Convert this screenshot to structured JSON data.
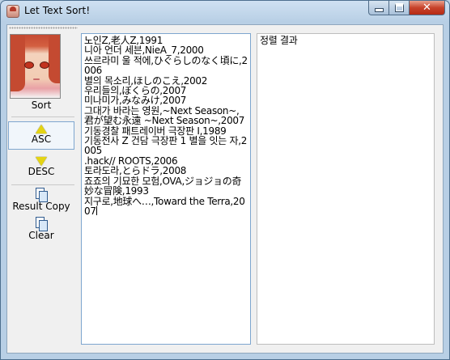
{
  "window": {
    "title": "Let Text Sort!",
    "close_glyph": "✕"
  },
  "sidebar": {
    "sort_label": "Sort",
    "asc_label": "ASC",
    "desc_label": "DESC",
    "copy_label": "Result Copy",
    "clear_label": "Clear"
  },
  "input": {
    "text": "노인Z,老人Z,1991\n니아 언더 세븐,NieA_7,2000\n쓰르라미 울 적에,ひぐらしのなく頃に,2006\n별의 목소리,ほしのこえ,2002\n우리들의,ぼくらの,2007\n미나미가,みなみけ,2007\n그대가 바라는 영원,~Next Season~,君が望む永遠 ~Next Season~,2007\n기동경찰 패트레이버 극장판 I,1989\n기동전사 Z 건담 극장판 1 별을 잇는 자,2005\n.hack// ROOTS,2006\n토라도라,とらドラ,2008\n죠죠의 기묘한 모험,OVA,ジョジョの奇妙な冒険,1993\n지구로,地球へ…,Toward the Terra,2007"
  },
  "output": {
    "text": "정렬 결과"
  },
  "colors": {
    "titlebar": "#cfe1f2",
    "close_button": "#c7432b",
    "arrow_yellow": "#e4d413",
    "focus_border": "#7ea6cf"
  }
}
